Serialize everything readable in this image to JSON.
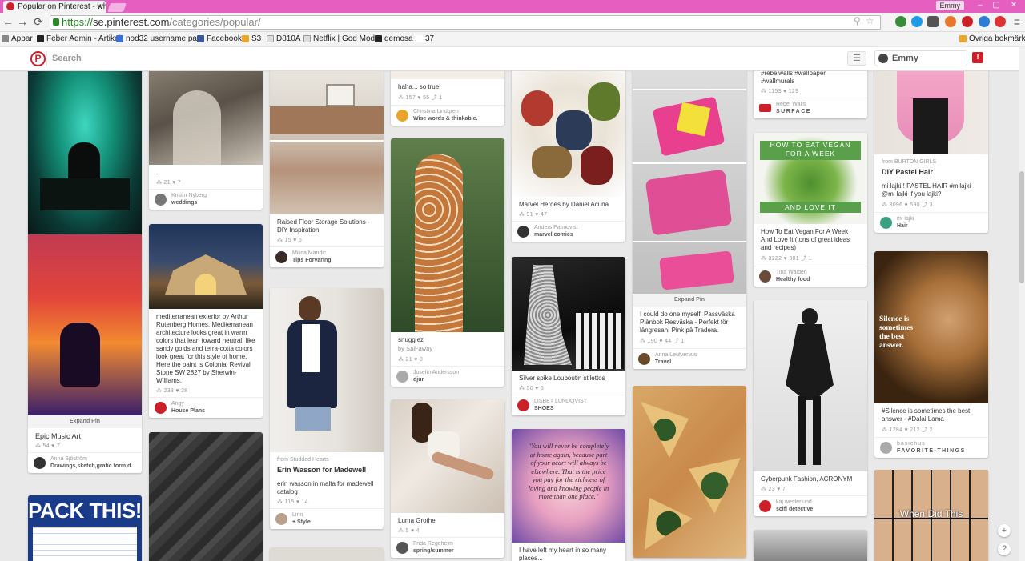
{
  "browser": {
    "tab_title": "Popular on Pinterest - wh",
    "tab_close": "×",
    "user_badge": "Emmy",
    "win_min": "–",
    "win_max": "▢",
    "win_close": "✕",
    "url_scheme": "https://",
    "url_host": "se.pinterest.com",
    "url_path": "/categories/popular/",
    "back": "←",
    "forward": "→",
    "reload": "⟳"
  },
  "bookmarks": {
    "apps": "Appar",
    "items": [
      "Feber Admin - Artikel",
      "nod32 username pa...",
      "Facebook",
      "S3",
      "D810A",
      "Netflix | God Mode",
      "demosa",
      "37"
    ],
    "other": "Övriga bokmärken"
  },
  "pinterest": {
    "logo": "P",
    "search_placeholder": "Search",
    "menu": "☰",
    "user": "Emmy",
    "notif": "!"
  },
  "cards": {
    "c1": {
      "expand": "Expand Pin",
      "title": "Epic Music Art",
      "stats": "⁂ 54   ♥ 7",
      "name": "Anna Sjöström",
      "board": "Drawings,sketch,grafic form,d..."
    },
    "c2": {
      "title": "PACK THIS!"
    },
    "c3": {
      "desc": ".",
      "stats": "⁂ 21   ♥ 7",
      "name": "Kristin Nyberg",
      "board": "weddings"
    },
    "c4": {
      "desc": "mediterranean exterior by Arthur Rutenberg Homes. Mediterranean architecture looks great in warm colors that lean toward neutral, like sandy golds and terra-cotta colors look great for this style of home. Here the paint is Colonial Revival Stone SW 2827 by Sherwin-Williams.",
      "stats": "⁂ 233   ♥ 28",
      "name": "Angy",
      "board": "House Plans"
    },
    "c6": {
      "desc": "Raised Floor Storage Solutions - DIY Inspiration",
      "stats": "⁂ 15   ♥ 5",
      "name": "Milica Mandic",
      "board": "Tips Förvaring"
    },
    "c7": {
      "from": "from Studded Hearts",
      "title": "Erin Wasson for Madewell",
      "desc": "erin wasson in malta for madewell catalog",
      "stats": "⁂ 115   ♥ 14",
      "name": "Linn",
      "board": "+ Style"
    },
    "c8": {
      "desc": "haha... so true!",
      "stats": "⁂ 157   ♥ 55   ⤴ 1",
      "name": "Christina Lindgren",
      "board": "Wise words & thinkable."
    },
    "c9": {
      "desc": "snugglez",
      "via": "by Sail-away",
      "stats": "⁂ 21   ♥ 8",
      "name": "Josefin Andersson",
      "board": "djur"
    },
    "c10": {
      "desc": "Luma Grothe",
      "stats": "⁂ 5   ♥ 4",
      "name": "Frida Regeheim",
      "board": "spring/summer"
    },
    "c11": {
      "desc": "Marvel Heroes by Daniel Acuna",
      "stats": "⁂ 91   ♥ 47",
      "name": "Anders Palmqvist",
      "board": "marvel comics"
    },
    "c12": {
      "desc": "Silver spike Louboutin stilettos",
      "stats": "⁂ 50   ♥ 6",
      "name": "LISBET LUNDQVIST",
      "board": "SHOES"
    },
    "c13": {
      "quote": "\"You will never be completely at home again, because part of your heart will always be elsewhere. That is the price you pay for the richness of loving and knowing people in more than one place.\"",
      "desc": "I have left my heart in so many places..."
    },
    "c14": {
      "expand": "Expand Pin",
      "desc": "I could do one myself. Passväska Plånbok Resväska - Perfekt för långresan! Pink på Tradera.",
      "stats": "⁂ 190   ♥ 44   ⤴ 1",
      "name": "Anna Leufvenius",
      "board": "Travel"
    },
    "c16": {
      "desc": "#rebelwalls #wallpaper #wallmurals",
      "stats": "⁂ 1153   ♥ 129",
      "name": "Rebel Walls",
      "board": "SURFACE"
    },
    "c17": {
      "banner1": "HOW TO EAT VEGAN",
      "banner2": "FOR A WEEK",
      "banner3": "AND LOVE IT",
      "desc": "How To Eat Vegan For A Week And Love It (tons of great ideas and recipes)",
      "stats": "⁂ 3222   ♥ 381   ⤴ 1",
      "name": "Tina Waldén",
      "board": "Healthy food"
    },
    "c18": {
      "desc": "Cyberpunk Fashion, ACRONYM",
      "stats": "⁂ 23   ♥ 7",
      "name": "kaj westerlund",
      "board": "scifi detective"
    },
    "c20": {
      "from": "from BURTON GIRLS",
      "title": "DIY Pastel Hair",
      "desc": "mi lajki ! PASTEL HAIR #milajki @mi lajki if you lajki?",
      "stats": "⁂ 3096   ♥ 590   ⤴ 3",
      "name": "mi lajki",
      "board": "Hair"
    },
    "c21": {
      "quote": "Silence is sometimes the best answer.",
      "desc": "#Silence is sometimes the best answer - #Dalai Lama",
      "stats": "⁂ 1284   ♥ 212   ⤴ 2",
      "name": "basichus",
      "board": "FAVORITE-THINGS"
    },
    "c22": {
      "caption1": "When",
      "caption2": "Did",
      "caption3": "This"
    }
  },
  "float": {
    "plus": "+",
    "help": "?"
  }
}
